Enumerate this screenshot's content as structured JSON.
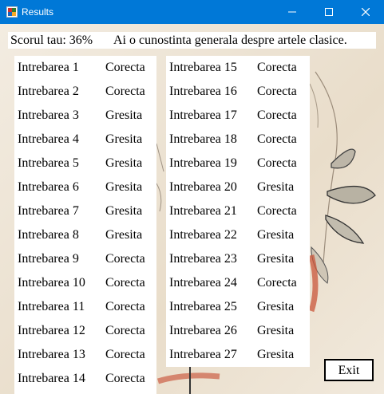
{
  "window": {
    "title": "Results"
  },
  "score": {
    "label": "Scorul tau: 36%",
    "message": "Ai o cunostinta generala despre artele clasice."
  },
  "results_left": [
    {
      "question": "Intrebarea 1",
      "status": "Corecta"
    },
    {
      "question": "Intrebarea 2",
      "status": "Corecta"
    },
    {
      "question": "Intrebarea 3",
      "status": "Gresita"
    },
    {
      "question": "Intrebarea 4",
      "status": "Gresita"
    },
    {
      "question": "Intrebarea 5",
      "status": "Gresita"
    },
    {
      "question": "Intrebarea 6",
      "status": "Gresita"
    },
    {
      "question": "Intrebarea 7",
      "status": "Gresita"
    },
    {
      "question": "Intrebarea 8",
      "status": "Gresita"
    },
    {
      "question": "Intrebarea 9",
      "status": "Corecta"
    },
    {
      "question": "Intrebarea 10",
      "status": "Corecta"
    },
    {
      "question": "Intrebarea 11",
      "status": "Corecta"
    },
    {
      "question": "Intrebarea 12",
      "status": "Corecta"
    },
    {
      "question": "Intrebarea 13",
      "status": "Corecta"
    },
    {
      "question": "Intrebarea 14",
      "status": "Corecta"
    }
  ],
  "results_right": [
    {
      "question": "Intrebarea 15",
      "status": "Corecta"
    },
    {
      "question": "Intrebarea 16",
      "status": "Corecta"
    },
    {
      "question": "Intrebarea 17",
      "status": "Corecta"
    },
    {
      "question": "Intrebarea 18",
      "status": "Corecta"
    },
    {
      "question": "Intrebarea 19",
      "status": "Corecta"
    },
    {
      "question": "Intrebarea 20",
      "status": "Gresita"
    },
    {
      "question": "Intrebarea 21",
      "status": "Corecta"
    },
    {
      "question": "Intrebarea 22",
      "status": "Gresita"
    },
    {
      "question": "Intrebarea 23",
      "status": "Gresita"
    },
    {
      "question": "Intrebarea 24",
      "status": "Corecta"
    },
    {
      "question": "Intrebarea 25",
      "status": "Gresita"
    },
    {
      "question": "Intrebarea 26",
      "status": "Gresita"
    },
    {
      "question": "Intrebarea 27",
      "status": "Gresita"
    }
  ],
  "exit_label": "Exit",
  "colors": {
    "titlebar": "#0078d7",
    "panel": "#ffffff",
    "background": "#ece2d2"
  }
}
